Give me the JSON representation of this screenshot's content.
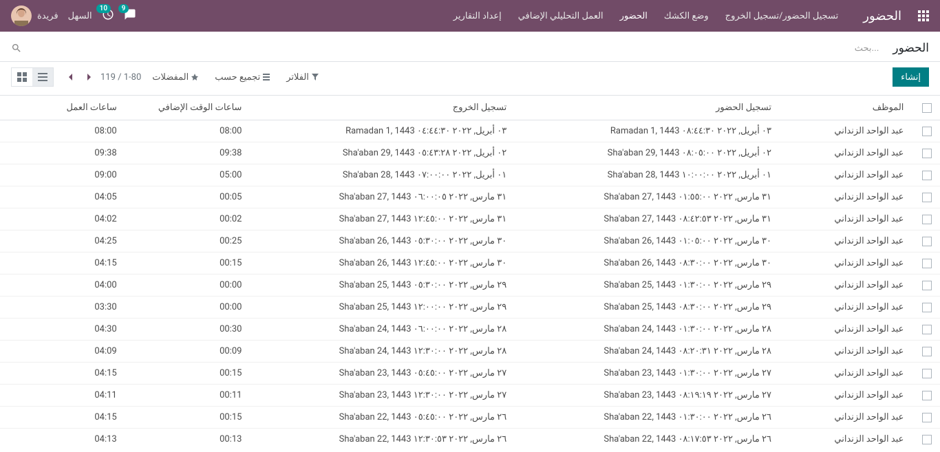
{
  "topbar": {
    "app_title": "الحضور",
    "nav": [
      "تسجيل الحضور/تسجيل الخروج",
      "وضع الكشك",
      "الحضور",
      "العمل التحليلي الإضافي",
      "إعداد التقارير"
    ],
    "sahl": "السهل",
    "username": "فريدة",
    "badge1": "9",
    "badge2": "10"
  },
  "subheader": {
    "breadcrumb": "الحضور",
    "search_placeholder": "بحث..."
  },
  "controls": {
    "create": "إنشاء",
    "filters": "الفلاتر",
    "group_by": "تجميع حسب",
    "favorites": "المفضلات",
    "pager": "1-80 / 119"
  },
  "table": {
    "headers": {
      "employee": "الموظف",
      "check_in": "تسجيل الحضور",
      "check_out": "تسجيل الخروج",
      "extra_hours": "ساعات الوقت الإضافي",
      "worked_hours": "ساعات العمل"
    },
    "rows": [
      {
        "emp": "عبد الواحد الزنداني",
        "in": "٠٣ أبريل, ٢٠٢٢ ٠٨:٤٤:٣٠ Ramadan 1, 1443",
        "out": "٠٣ أبريل, ٢٠٢٢ ٠٤:٤٤:٣٠ Ramadan 1, 1443",
        "extra": "08:00",
        "work": "08:00"
      },
      {
        "emp": "عبد الواحد الزنداني",
        "in": "٠٢ أبريل, ٢٠٢٢ ٠٨:٠٥:٠٠ Sha'aban 29, 1443",
        "out": "٠٢ أبريل, ٢٠٢٢ ٠٥:٤٣:٢٨ Sha'aban 29, 1443",
        "extra": "09:38",
        "work": "09:38"
      },
      {
        "emp": "عبد الواحد الزنداني",
        "in": "٠١ أبريل, ٢٠٢٢ ١٠:٠٠:٠٠ Sha'aban 28, 1443",
        "out": "٠١ أبريل, ٢٠٢٢ ٠٧:٠٠:٠٠ Sha'aban 28, 1443",
        "extra": "05:00",
        "work": "09:00"
      },
      {
        "emp": "عبد الواحد الزنداني",
        "in": "٣١ مارس, ٢٠٢٢ ٠١:٥٥:٠٠ Sha'aban 27, 1443",
        "out": "٣١ مارس, ٢٠٢٢ ٠٦:٠٠:٠٥ Sha'aban 27, 1443",
        "extra": "00:05",
        "work": "04:05"
      },
      {
        "emp": "عبد الواحد الزنداني",
        "in": "٣١ مارس, ٢٠٢٢ ٠٨:٤٢:٥٣ Sha'aban 27, 1443",
        "out": "٣١ مارس, ٢٠٢٢ ١٢:٤٥:٠٠ Sha'aban 27, 1443",
        "extra": "00:02",
        "work": "04:02"
      },
      {
        "emp": "عبد الواحد الزنداني",
        "in": "٣٠ مارس, ٢٠٢٢ ٠١:٠٥:٠٠ Sha'aban 26, 1443",
        "out": "٣٠ مارس, ٢٠٢٢ ٠٥:٣٠:٠٠ Sha'aban 26, 1443",
        "extra": "00:25",
        "work": "04:25"
      },
      {
        "emp": "عبد الواحد الزنداني",
        "in": "٣٠ مارس, ٢٠٢٢ ٠٨:٣٠:٠٠ Sha'aban 26, 1443",
        "out": "٣٠ مارس, ٢٠٢٢ ١٢:٤٥:٠٠ Sha'aban 26, 1443",
        "extra": "00:15",
        "work": "04:15"
      },
      {
        "emp": "عبد الواحد الزنداني",
        "in": "٢٩ مارس, ٢٠٢٢ ٠١:٣٠:٠٠ Sha'aban 25, 1443",
        "out": "٢٩ مارس, ٢٠٢٢ ٠٥:٣٠:٠٠ Sha'aban 25, 1443",
        "extra": "00:00",
        "work": "04:00"
      },
      {
        "emp": "عبد الواحد الزنداني",
        "in": "٢٩ مارس, ٢٠٢٢ ٠٨:٣٠:٠٠ Sha'aban 25, 1443",
        "out": "٢٩ مارس, ٢٠٢٢ ١٢:٠٠:٠٠ Sha'aban 25, 1443",
        "extra": "00:00",
        "work": "03:30"
      },
      {
        "emp": "عبد الواحد الزنداني",
        "in": "٢٨ مارس, ٢٠٢٢ ٠١:٣٠:٠٠ Sha'aban 24, 1443",
        "out": "٢٨ مارس, ٢٠٢٢ ٠٦:٠٠:٠٠ Sha'aban 24, 1443",
        "extra": "00:30",
        "work": "04:30"
      },
      {
        "emp": "عبد الواحد الزنداني",
        "in": "٢٨ مارس, ٢٠٢٢ ٠٨:٢٠:٣١ Sha'aban 24, 1443",
        "out": "٢٨ مارس, ٢٠٢٢ ١٢:٣٠:٠٠ Sha'aban 24, 1443",
        "extra": "00:09",
        "work": "04:09"
      },
      {
        "emp": "عبد الواحد الزنداني",
        "in": "٢٧ مارس, ٢٠٢٢ ٠١:٣٠:٠٠ Sha'aban 23, 1443",
        "out": "٢٧ مارس, ٢٠٢٢ ٠٥:٤٥:٠٠ Sha'aban 23, 1443",
        "extra": "00:15",
        "work": "04:15"
      },
      {
        "emp": "عبد الواحد الزنداني",
        "in": "٢٧ مارس, ٢٠٢٢ ٠٨:١٩:١٩ Sha'aban 23, 1443",
        "out": "٢٧ مارس, ٢٠٢٢ ١٢:٣٠:٠٠ Sha'aban 23, 1443",
        "extra": "00:11",
        "work": "04:11"
      },
      {
        "emp": "عبد الواحد الزنداني",
        "in": "٢٦ مارس, ٢٠٢٢ ٠١:٣٠:٠٠ Sha'aban 22, 1443",
        "out": "٢٦ مارس, ٢٠٢٢ ٠٥:٤٥:٠٠ Sha'aban 22, 1443",
        "extra": "00:15",
        "work": "04:15"
      },
      {
        "emp": "عبد الواحد الزنداني",
        "in": "٢٦ مارس, ٢٠٢٢ ٠٨:١٧:٥٣ Sha'aban 22, 1443",
        "out": "٢٦ مارس, ٢٠٢٢ ١٢:٣٠:٥٣ Sha'aban 22, 1443",
        "extra": "00:13",
        "work": "04:13"
      }
    ]
  }
}
